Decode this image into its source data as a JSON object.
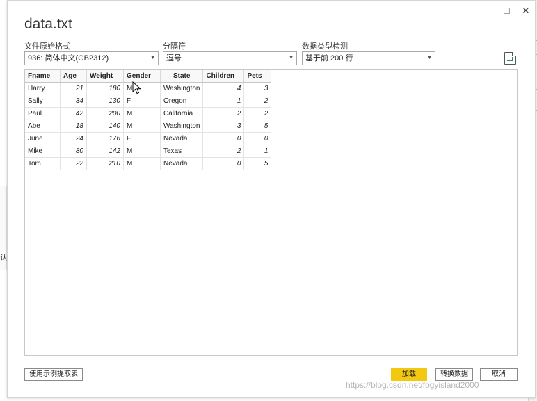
{
  "window": {
    "title": "data.txt",
    "maximize_icon": "□",
    "close_icon": "✕"
  },
  "settings": {
    "encoding": {
      "label": "文件原始格式",
      "value": "936: 简体中文(GB2312)"
    },
    "delimiter": {
      "label": "分隔符",
      "value": "逗号"
    },
    "detection": {
      "label": "数据类型检测",
      "value": "基于前 200 行"
    },
    "refresh_icon": "file-refresh-icon"
  },
  "table": {
    "columns": [
      "Fname",
      "Age",
      "Weight",
      "Gender",
      "State",
      "Children",
      "Pets"
    ],
    "rows": [
      [
        "Harry",
        "21",
        "180",
        "M",
        "Washington",
        "4",
        "3"
      ],
      [
        "Sally",
        "34",
        "130",
        "F",
        "Oregon",
        "1",
        "2"
      ],
      [
        "Paul",
        "42",
        "200",
        "M",
        "California",
        "2",
        "2"
      ],
      [
        "Abe",
        "18",
        "140",
        "M",
        "Washington",
        "3",
        "5"
      ],
      [
        "June",
        "24",
        "176",
        "F",
        "Nevada",
        "0",
        "0"
      ],
      [
        "Mike",
        "80",
        "142",
        "M",
        "Texas",
        "2",
        "1"
      ],
      [
        "Tom",
        "22",
        "210",
        "M",
        "Nevada",
        "0",
        "5"
      ]
    ]
  },
  "footer": {
    "extract_label": "使用示例提取表",
    "load_label": "加载",
    "transform_label": "转换数据",
    "cancel_label": "取消"
  },
  "colors": {
    "accent": "#f2c811"
  },
  "watermark": "https://blog.csdn.net/fogyisland2000",
  "background_glyph": "认"
}
